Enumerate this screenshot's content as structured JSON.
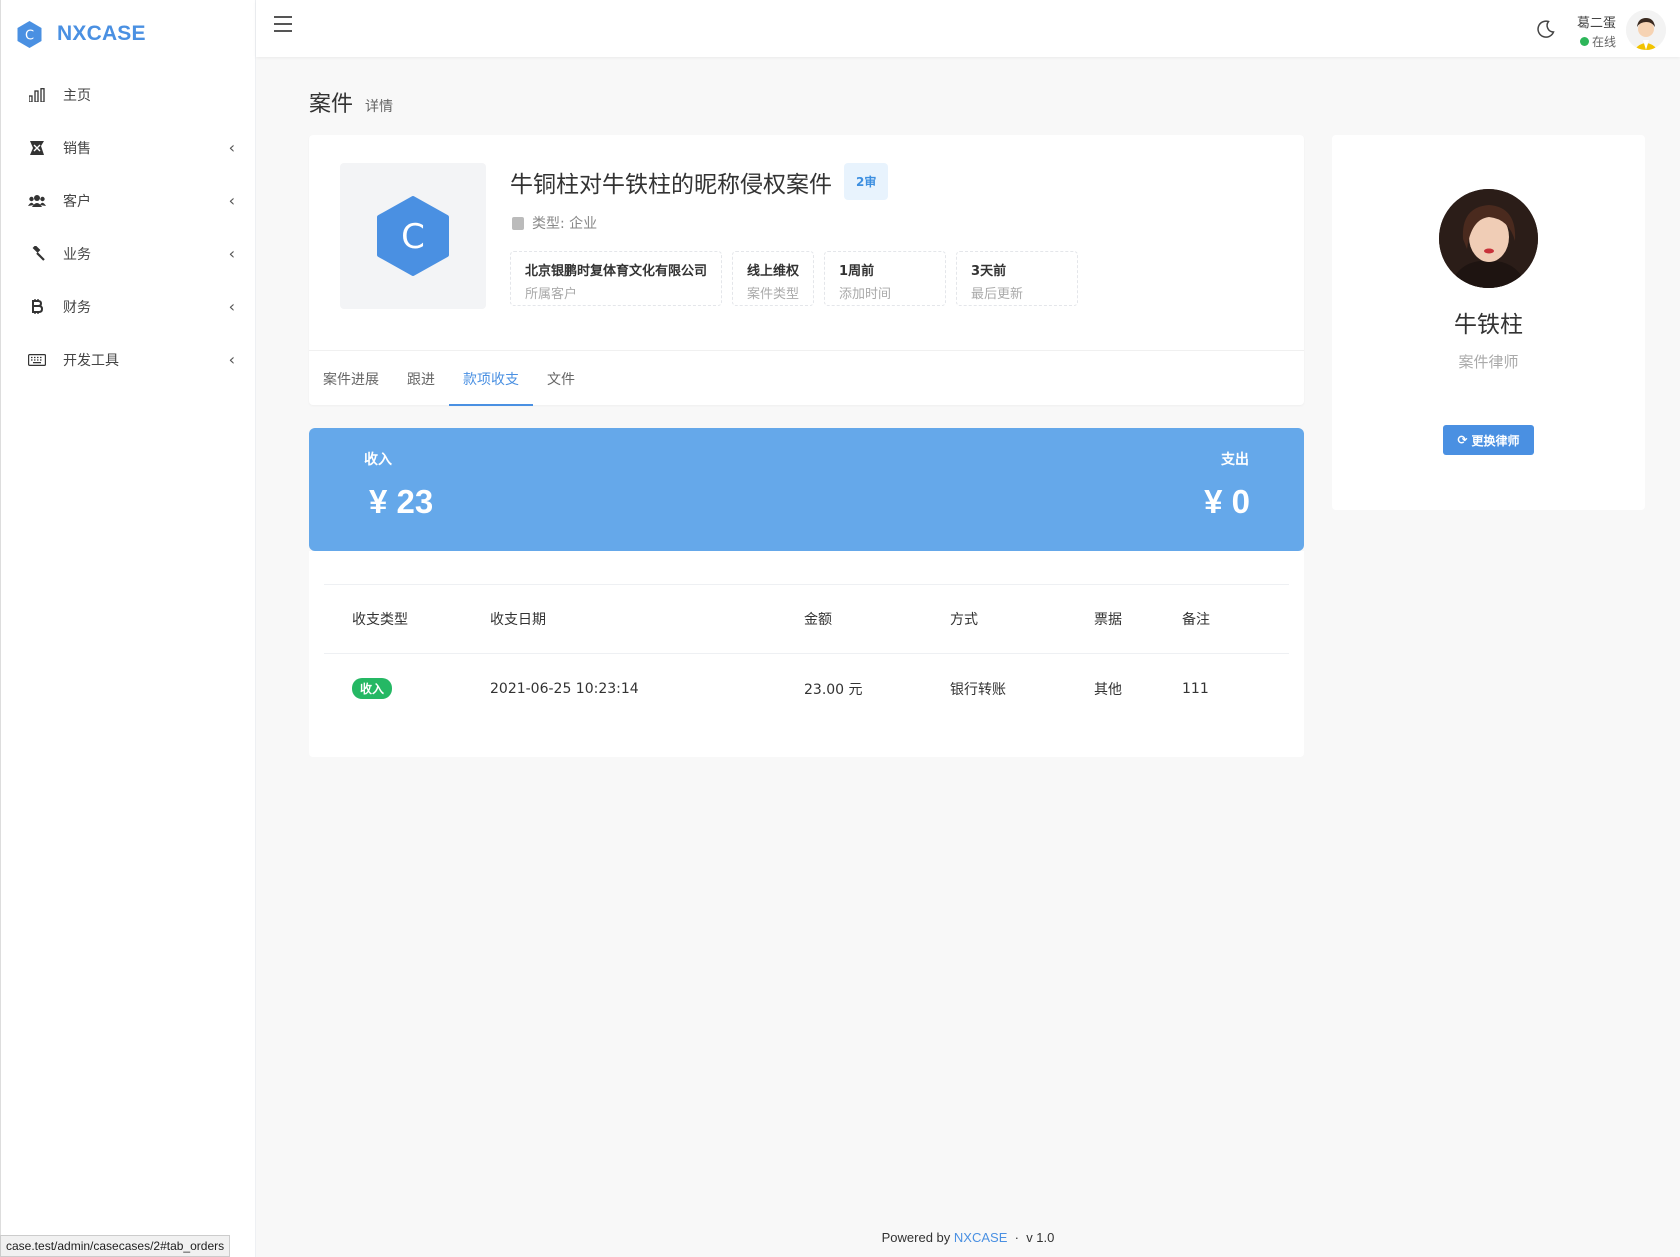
{
  "brand": {
    "name": "NXCASE",
    "logo_letter": "C",
    "accent": "#4a90e2"
  },
  "sidebar": {
    "items": [
      {
        "label": "主页",
        "icon": "bar-chart-icon",
        "has_submenu": false
      },
      {
        "label": "销售",
        "icon": "sales-icon",
        "has_submenu": true
      },
      {
        "label": "客户",
        "icon": "users-icon",
        "has_submenu": true
      },
      {
        "label": "业务",
        "icon": "gavel-icon",
        "has_submenu": true
      },
      {
        "label": "财务",
        "icon": "bitcoin-icon",
        "has_submenu": true
      },
      {
        "label": "开发工具",
        "icon": "keyboard-icon",
        "has_submenu": true
      }
    ],
    "chevron": "‹"
  },
  "topbar": {
    "user_name": "葛二蛋",
    "user_status": "在线",
    "status_color": "#2db65a"
  },
  "page": {
    "title": "案件",
    "subtitle": "详情"
  },
  "case": {
    "logo_letter": "C",
    "title": "牛铜柱对牛铁柱的昵称侵权案件",
    "stage_badge": "2审",
    "type_text": "类型: 企业",
    "stats": [
      {
        "value": "北京银鹏时复体育文化有限公司",
        "label": "所属客户"
      },
      {
        "value": "线上维权",
        "label": "案件类型"
      },
      {
        "value": "1周前",
        "label": "添加时间"
      },
      {
        "value": "3天前",
        "label": "最后更新"
      }
    ],
    "tabs": [
      {
        "label": "案件进展",
        "active": false
      },
      {
        "label": "跟进",
        "active": false
      },
      {
        "label": "款项收支",
        "active": true
      },
      {
        "label": "文件",
        "active": false
      }
    ]
  },
  "finance": {
    "income_label": "收入",
    "income_value": "¥ 23",
    "expense_label": "支出",
    "expense_value": "¥ 0",
    "banner_color": "#65a8ea"
  },
  "orders": {
    "headers": [
      "收支类型",
      "收支日期",
      "金额",
      "方式",
      "票据",
      "备注"
    ],
    "rows": [
      {
        "type": "收入",
        "date": "2021-06-25 10:23:14",
        "amount": "23.00 元",
        "method": "银行转账",
        "receipt": "其他",
        "note": "111"
      }
    ]
  },
  "lawyer": {
    "name": "牛铁柱",
    "role": "案件律师",
    "change_button": "更换律师"
  },
  "footer": {
    "prefix": "Powered by",
    "link": "NXCASE",
    "separator": "·",
    "version": "v 1.0"
  },
  "status_bar": {
    "url": "case.test/admin/casecases/2#tab_orders"
  }
}
